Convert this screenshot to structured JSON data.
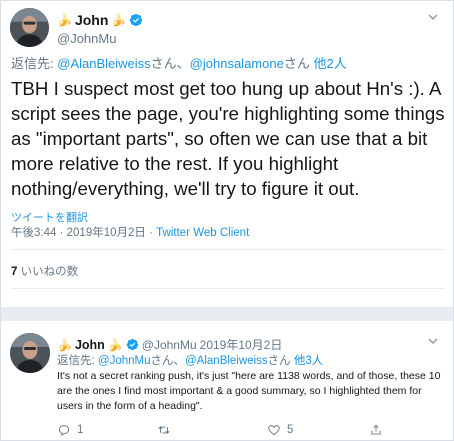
{
  "main_tweet": {
    "author": {
      "emoji_left": "🍌",
      "name": "John",
      "emoji_right": "🍌",
      "handle": "@JohnMu"
    },
    "reply_to": {
      "prefix": "返信先:",
      "mention1": "@AlanBleiweiss",
      "san1": "さん、",
      "mention2": "@johnsalamone",
      "san2": "さん",
      "others": "他2人"
    },
    "text": "TBH I suspect most get too hung up about Hn's :). A script sees the page, you're highlighting some things as \"important parts\", so often we can use that a bit more relative to the rest. If you highlight nothing/everything, we'll try to figure it out.",
    "translate_label": "ツイートを翻訳",
    "time": "午後3:44",
    "separator": "·",
    "date": "2019年10月2日",
    "separator2": "·",
    "client": "Twitter Web Client",
    "likes_count": "7",
    "likes_label": "いいねの数"
  },
  "reply_tweet": {
    "author": {
      "emoji_left": "🍌",
      "name": "John",
      "emoji_right": "🍌",
      "handle": "@JohnMu",
      "date": "2019年10月2日"
    },
    "reply_to": {
      "prefix": "返信先:",
      "mention1": "@JohnMu",
      "san1": "さん、",
      "mention2": "@AlanBleiweiss",
      "san2": "さん",
      "others": "他3人"
    },
    "text": "It's not a secret ranking push, it's just \"here are 1138 words, and of those, these 10 are the ones I find most important & a good summary, so I highlighted them for users in the form of a heading\".",
    "reply_count": "1",
    "retweet_count": "",
    "like_count": "5"
  },
  "icons": {
    "verified": "verified-badge-icon",
    "caret": "chevron-down-icon",
    "reply": "reply-bubble-icon",
    "retweet": "retweet-icon",
    "like": "heart-icon",
    "share": "share-icon"
  },
  "colors": {
    "link": "#1b95e0",
    "secondary": "#657786",
    "text": "#14171a",
    "divider": "#e6ecf0",
    "verified": "#1da1f2"
  }
}
